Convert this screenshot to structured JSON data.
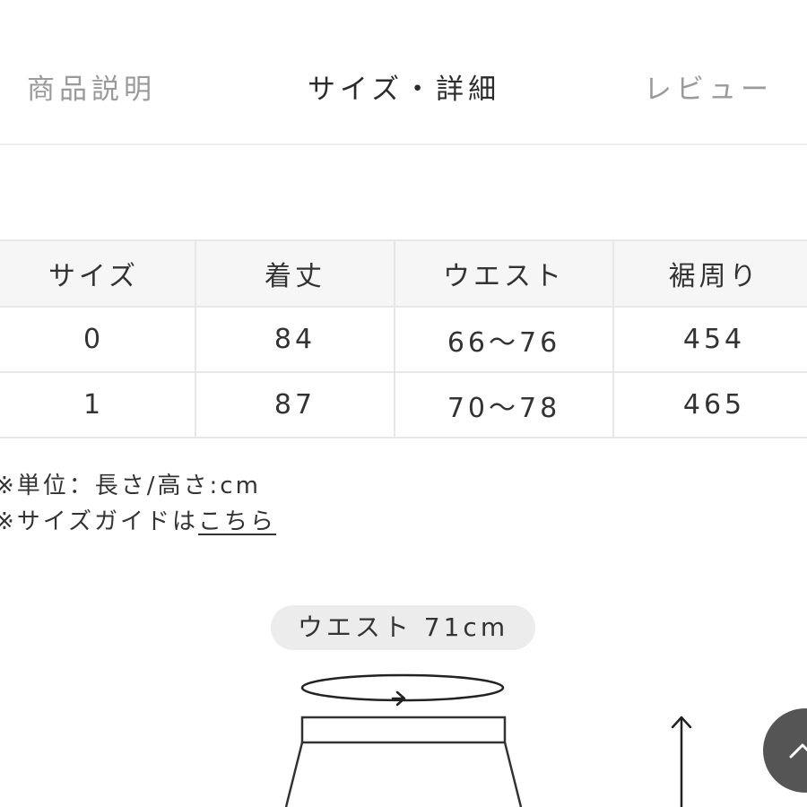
{
  "tabs": [
    {
      "label": "商品説明",
      "active": false
    },
    {
      "label": "サイズ・詳細",
      "active": true
    },
    {
      "label": "レビュー",
      "active": false
    }
  ],
  "size_table": {
    "headers": [
      "サイズ",
      "着丈",
      "ウエスト",
      "裾周り"
    ],
    "rows": [
      [
        "0",
        "84",
        "66〜76",
        "454"
      ],
      [
        "1",
        "87",
        "70〜78",
        "465"
      ]
    ]
  },
  "notes": {
    "unit": "※単位：長さ/高さ:cm",
    "guide_prefix": "※サイズガイドは",
    "guide_link": "こちら"
  },
  "diagram": {
    "waist_label": "ウエスト 71cm"
  },
  "icons": {
    "scroll_top": "chevron-up-icon",
    "waist_arrow": "circular-arrow-icon",
    "length_arrow": "arrow-up-icon"
  },
  "colors": {
    "active_tab": "#2b2b2b",
    "inactive_tab": "#9a9a9a",
    "table_header_bg": "#f6f6f6",
    "table_border": "#e7e7e7",
    "pill_bg": "#ececec",
    "scroll_button_bg": "#555555"
  }
}
